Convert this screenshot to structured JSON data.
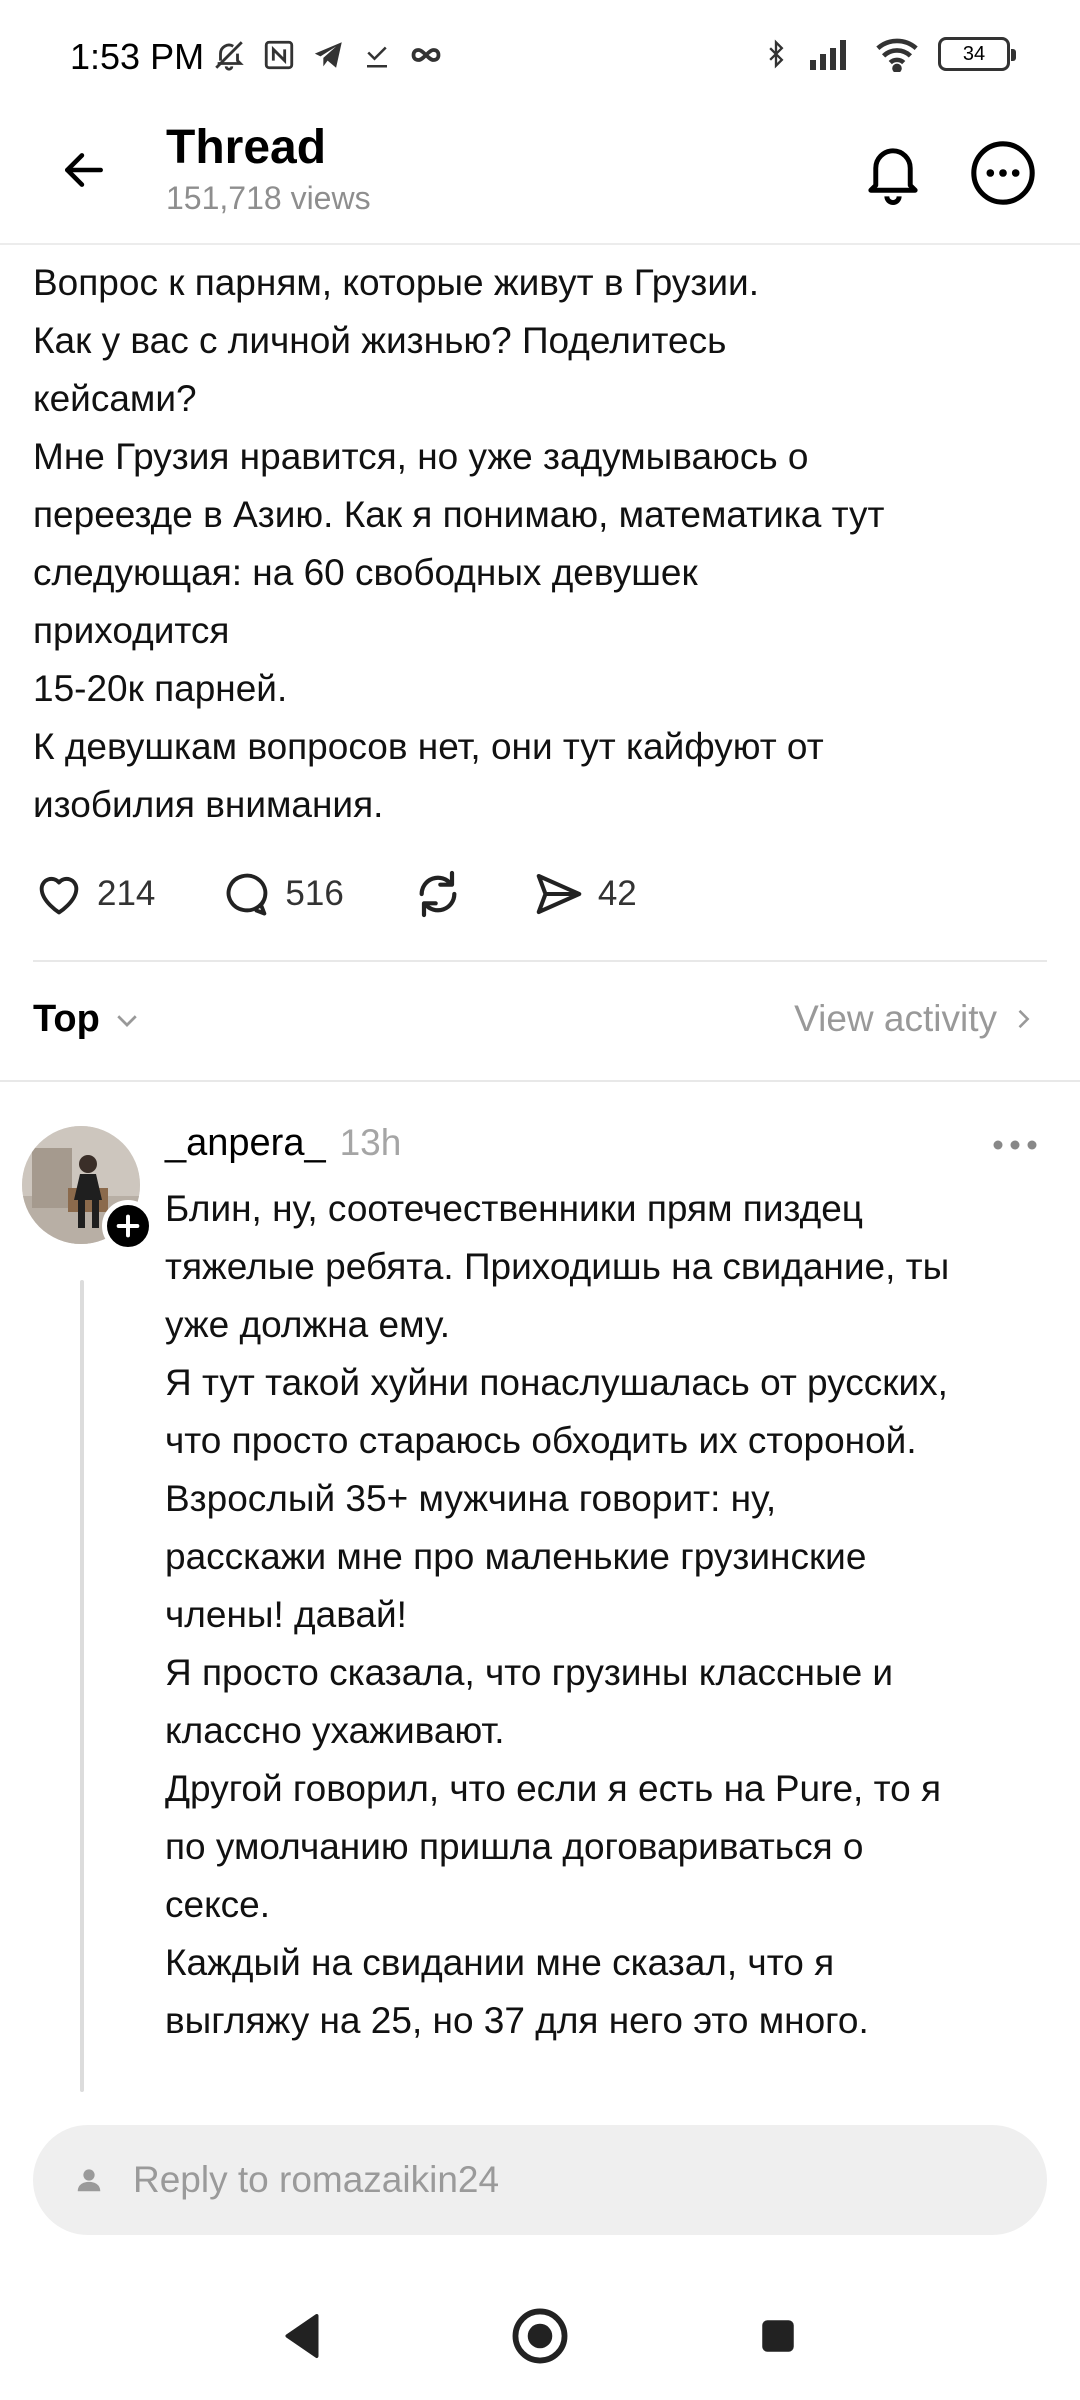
{
  "status_bar": {
    "time": "1:53 PM",
    "battery": "34",
    "left_icons": [
      "mute-bell-icon",
      "nfc-icon",
      "telegram-icon",
      "download-done-icon",
      "infinity-icon"
    ],
    "right_icons": [
      "bluetooth-icon",
      "signal-icon",
      "wifi-icon",
      "battery-icon"
    ]
  },
  "header": {
    "title": "Thread",
    "views": "151,718 views"
  },
  "post": {
    "text": "Вопрос к парням, которые живут в Грузии.\nКак у вас с личной жизнью? Поделитесь\nкейсами?\nМне Грузия нравится, но уже задумываюсь о\nпереезде в Азию. Как я понимаю, математика тут\nследующая: на 60 свободных девушек\nприходится\n15-20к парней.\nК девушкам вопросов нет, они тут кайфуют от\nизобилия внимания.",
    "likes": "214",
    "comments": "516",
    "shares": "42"
  },
  "sort": {
    "label": "Top",
    "activity": "View activity"
  },
  "reply": {
    "username": "_anpera_",
    "time": "13h",
    "text": "Блин, ну, соотечественники прям пиздец\nтяжелые ребята. Приходишь на свидание, ты\nуже должна ему.\nЯ тут такой хуйни понаслушалась от русских,\nчто просто стараюсь обходить их стороной.\nВзрослый 35+ мужчина говорит: ну,\nрасскажи мне про маленькие грузинские\nчлены! давай!\nЯ просто сказала, что грузины классные и\nклассно ухаживают.\nДругой говорил, что если я есть на Pure, то я\nпо умолчанию пришла договариваться о\nсексе.\nКаждый на свидании мне сказал, что я\nвыгляжу на 25, но 37 для него это много."
  },
  "reply_bar": {
    "placeholder": "Reply to romazaikin24"
  },
  "colors": {
    "text": "#111111",
    "muted": "#8e8e8e",
    "divider": "#e8e8e8",
    "input_bg": "#efefef"
  }
}
